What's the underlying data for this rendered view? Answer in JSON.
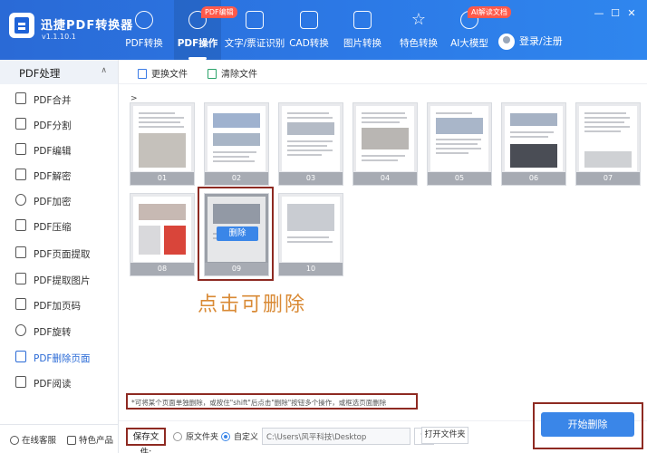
{
  "app": {
    "name": "迅捷PDF转换器",
    "version": "v1.1.10.1"
  },
  "nav": [
    {
      "label": "PDF转换",
      "icon": "refresh-icon"
    },
    {
      "label": "PDF操作",
      "icon": "gear-icon",
      "active": true,
      "tag": "PDF编辑"
    },
    {
      "label": "文字/票证识别",
      "icon": "scan-icon"
    },
    {
      "label": "CAD转换",
      "icon": "cad-icon"
    },
    {
      "label": "图片转换",
      "icon": "image-icon"
    },
    {
      "label": "特色转换",
      "icon": "star-icon"
    },
    {
      "label": "AI大模型",
      "icon": "ai-icon",
      "tag": "AI解读文档"
    }
  ],
  "login": {
    "label": "登录/注册"
  },
  "window": {
    "min": "—",
    "max": "☐",
    "close": "✕"
  },
  "sidebar": {
    "header": "PDF处理",
    "items": [
      {
        "label": "PDF合并",
        "icon": "merge-icon"
      },
      {
        "label": "PDF分割",
        "icon": "split-icon"
      },
      {
        "label": "PDF编辑",
        "icon": "edit-icon"
      },
      {
        "label": "PDF解密",
        "icon": "unlock-icon"
      },
      {
        "label": "PDF加密",
        "icon": "shield-icon"
      },
      {
        "label": "PDF压缩",
        "icon": "compress-icon"
      },
      {
        "label": "PDF页面提取",
        "icon": "extract-page-icon"
      },
      {
        "label": "PDF提取图片",
        "icon": "extract-image-icon"
      },
      {
        "label": "PDF加页码",
        "icon": "page-number-icon"
      },
      {
        "label": "PDF旋转",
        "icon": "rotate-icon"
      },
      {
        "label": "PDF删除页面",
        "icon": "delete-page-icon",
        "active": true
      },
      {
        "label": "PDF阅读",
        "icon": "book-icon"
      }
    ],
    "footer": {
      "service": "在线客服",
      "featured": "特色产品"
    }
  },
  "toolbar": {
    "replace_file": "更换文件",
    "clear_files": "清除文件"
  },
  "breadcrumb": ">",
  "pages": [
    "01",
    "02",
    "03",
    "04",
    "05",
    "06",
    "07",
    "08",
    "09",
    "10"
  ],
  "selected_page": "09",
  "delete_label": "删除",
  "annotation": "点击可删除",
  "hint": "*可将某个页面单独删除，或按住\"shift\"后点击\"删除\"按钮多个操作，或框选页面删除",
  "save": {
    "label": "保存文件:",
    "option_original": "原文件夹",
    "option_custom": "自定义",
    "path": "C:\\Users\\风平科技\\Desktop",
    "browse": "···",
    "open_folder": "打开文件夹"
  },
  "start_button": "开始删除",
  "colors": {
    "primary": "#2a6ad6",
    "button": "#3a86e8",
    "tag": "#ff5a4a",
    "annotation": "#d98a35",
    "highlight_box": "#8e2a22"
  }
}
